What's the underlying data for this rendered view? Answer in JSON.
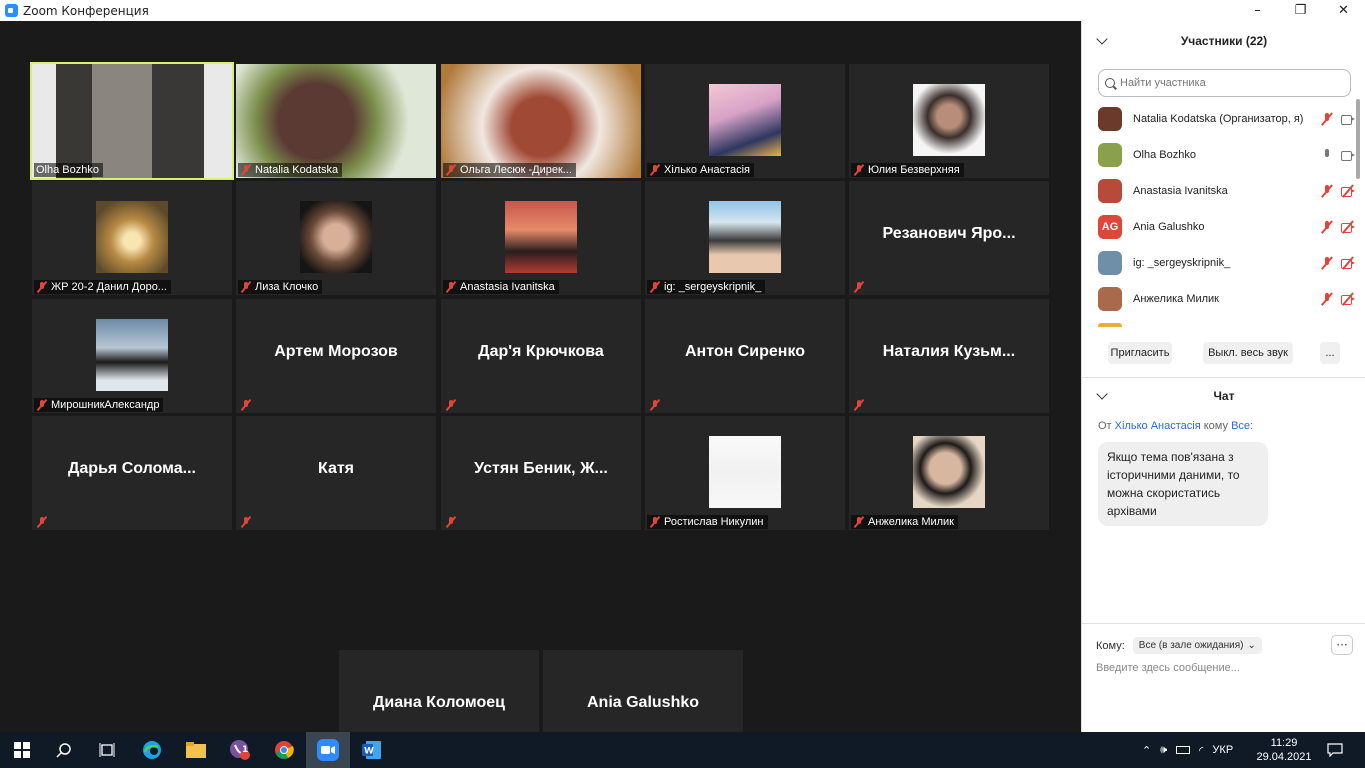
{
  "window": {
    "title": "Zoom Конференция",
    "minimize": "–",
    "maximize": "❐",
    "close": "✕"
  },
  "tiles": [
    {
      "name": "Olha Bozhko",
      "muted": false,
      "active": true
    },
    {
      "name": "Natalia Kodatska",
      "muted": true
    },
    {
      "name": "Ольга Лесюк -Дирек...",
      "muted": true
    },
    {
      "name": "Хілько  Анастасія",
      "muted": true
    },
    {
      "name": "Юлия Безверхняя",
      "muted": true
    },
    {
      "name": "ЖР 20-2 Данил Доро...",
      "muted": true
    },
    {
      "name": "Лиза Клочко",
      "muted": true
    },
    {
      "name": "Anastasia Ivanitska",
      "muted": true
    },
    {
      "name": "ig: _sergeyskripnik_",
      "muted": true
    },
    {
      "big": "Резанович  Яро...",
      "muted": true
    },
    {
      "name": "МирошникАлександр",
      "muted": true
    },
    {
      "big": "Артем Морозов",
      "muted": true
    },
    {
      "big": "Дар'я Крючкова",
      "muted": true
    },
    {
      "big": "Антон Сиренко",
      "muted": true
    },
    {
      "big": "Наталия  Кузьм...",
      "muted": true
    },
    {
      "big": "Дарья  Солома...",
      "muted": true
    },
    {
      "big": "Катя",
      "muted": true
    },
    {
      "big": "Устян  Беник, Ж...",
      "muted": true
    },
    {
      "name": "Ростислав Никулин",
      "muted": true
    },
    {
      "name": "Анжелика Милик",
      "muted": true
    },
    {
      "big": "Диана Коломоец",
      "muted": true
    },
    {
      "big": "Ania Galushko",
      "muted": true
    }
  ],
  "participants": {
    "header": "Участники (22)",
    "search_placeholder": "Найти участника",
    "list": [
      {
        "name": "Natalia Kodatska (Организатор, я)",
        "mic": "off",
        "cam": "on",
        "avatar_color": "#6b3a2a"
      },
      {
        "name": "Olha Bozhko",
        "mic": "on",
        "cam": "on",
        "avatar_color": "#8aa04a"
      },
      {
        "name": "Anastasia Ivanitska",
        "mic": "off",
        "cam": "off",
        "avatar_color": "#b84a3a"
      },
      {
        "name": "Ania Galushko",
        "initials": "AG",
        "mic": "off",
        "cam": "off",
        "avatar_color": "#e0453a"
      },
      {
        "name": "ig: _sergeyskripnik_",
        "mic": "off",
        "cam": "off",
        "avatar_color": "#6f8fa8"
      },
      {
        "name": "Анжелика Милик",
        "mic": "off",
        "cam": "off",
        "avatar_color": "#a86a4a"
      }
    ],
    "invite": "Пригласить",
    "mute_all": "Выкл. весь звук",
    "more": "..."
  },
  "chat": {
    "header": "Чат",
    "from_label": "От",
    "from_name": "Хілько  Анастасія",
    "to_word": "кому",
    "to_name": "Все:",
    "message": "Якщо тема пов'язана з історичними даними, то можна скористатись архівами",
    "to_label": "Кому:",
    "to_select": "Все (в зале ожидания)",
    "more": "···",
    "input_placeholder": "Введите здесь сообщение..."
  },
  "taskbar": {
    "lang": "УКР",
    "time": "11:29",
    "date": "29.04.2021",
    "badge": "1"
  },
  "colors": {
    "accent": "#2d8cff",
    "muted_red": "#e0453a",
    "active_border": "#d8f06f"
  }
}
